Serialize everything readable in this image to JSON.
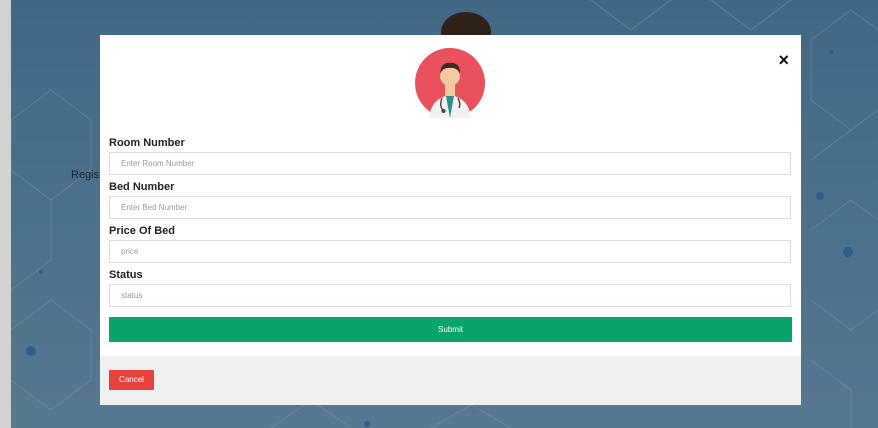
{
  "background": {
    "partial_text": "Register D"
  },
  "modal": {
    "close_icon": "×",
    "avatar": "doctor-avatar",
    "fields": [
      {
        "label": "Room Number",
        "placeholder": "Enter Room Number"
      },
      {
        "label": "Bed Number",
        "placeholder": "Enter Bed Number"
      },
      {
        "label": "Price Of Bed",
        "placeholder": "price"
      },
      {
        "label": "Status",
        "placeholder": "status"
      }
    ],
    "submit_label": "Submit",
    "cancel_label": "Cancel"
  },
  "colors": {
    "submit": "#09a46c",
    "cancel": "#e8403a",
    "avatar_circle": "#e9525c"
  }
}
